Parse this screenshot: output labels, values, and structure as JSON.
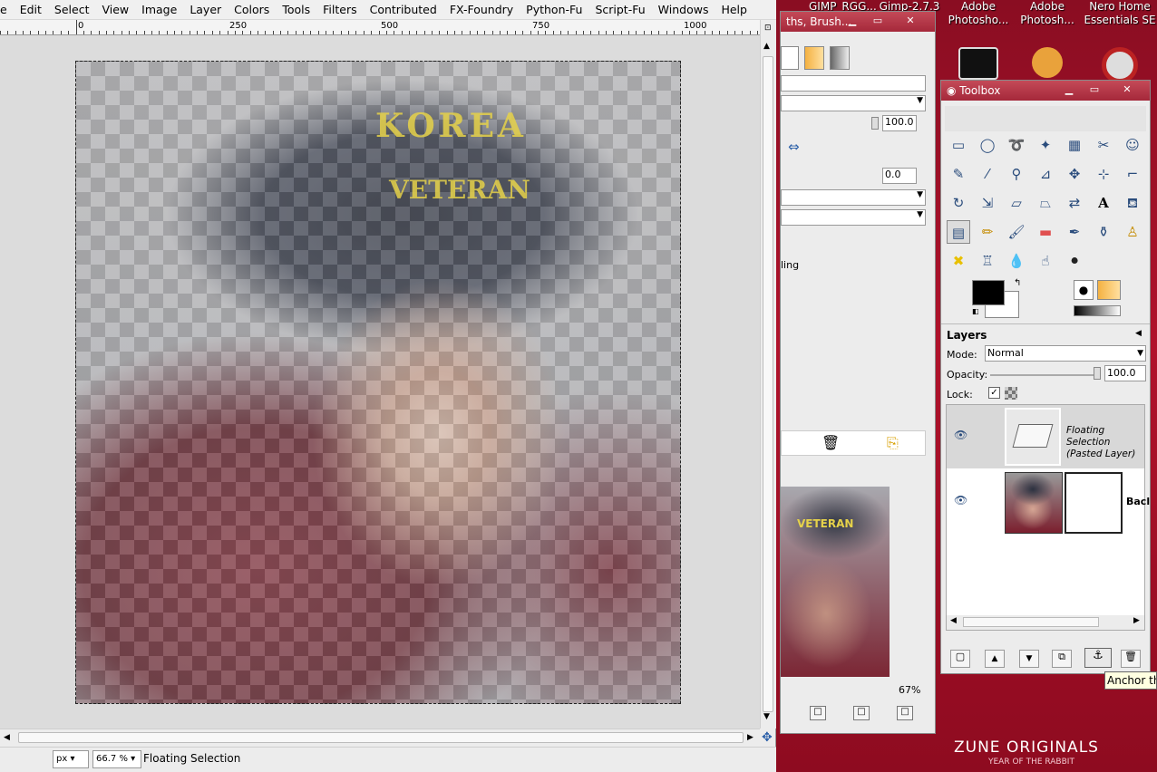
{
  "menubar": {
    "items": [
      "e",
      "Edit",
      "Select",
      "View",
      "Image",
      "Layer",
      "Colors",
      "Tools",
      "Filters",
      "Contributed",
      "FX-Foundry",
      "Python-Fu",
      "Script-Fu",
      "Windows",
      "Help"
    ]
  },
  "ruler": {
    "labels": [
      "0",
      "250",
      "500",
      "750",
      "1000"
    ]
  },
  "canvas": {
    "hat_line1": "KOREA",
    "hat_line2": "VETERAN"
  },
  "status": {
    "unit": "px",
    "zoom": "66.7 %",
    "message": "Floating Selection"
  },
  "desktop": {
    "taskbar_items": [
      "GIMP_RGG...",
      "Gimp-2.7.3"
    ],
    "icons": [
      {
        "label_line1": "Adobe",
        "label_line2": "Photosho..."
      },
      {
        "label_line1": "Adobe",
        "label_line2": "Photosh..."
      },
      {
        "label_line1": "Nero Home",
        "label_line2": "Essentials SE"
      }
    ],
    "zune_logo": "ZUNE ORIGINALS",
    "zune_sub": "YEAR OF THE RABBIT"
  },
  "dock": {
    "title": "ths, Brush...",
    "opacity_value": "100.0",
    "angle_value": "0.0",
    "partial_label": "ling",
    "zoom_percent": "67%",
    "preview_hat_text": "VETERAN"
  },
  "toolbox": {
    "title": "Toolbox",
    "layers_title": "Layers",
    "mode_label": "Mode:",
    "mode_value": "Normal",
    "opacity_label": "Opacity:",
    "opacity_value": "100.0",
    "lock_label": "Lock:",
    "layers": [
      {
        "name_line1": "Floating Selection",
        "name_line2": "(Pasted Layer)"
      },
      {
        "name_line1": "Bacl",
        "name_line2": ""
      }
    ],
    "tooltip": "Anchor the"
  }
}
